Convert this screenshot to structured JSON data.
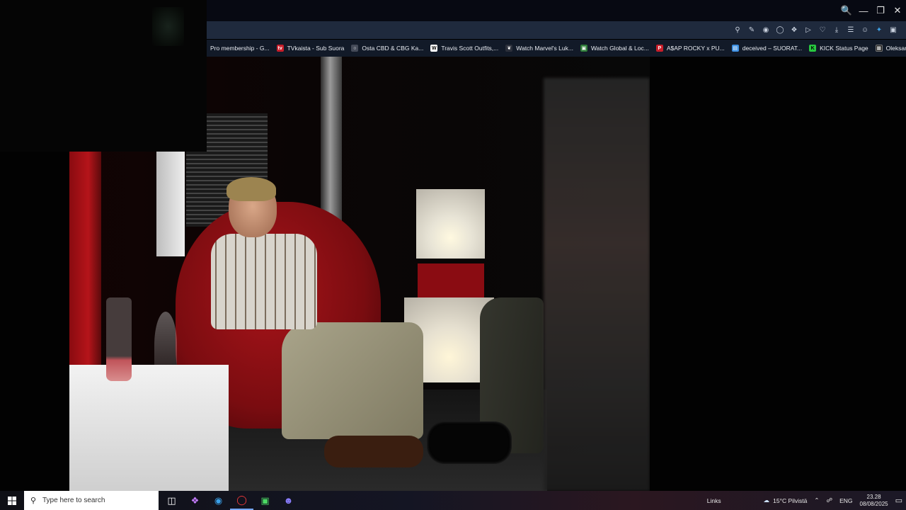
{
  "window": {
    "minimize": "—",
    "restore": "❐",
    "close": "✕"
  },
  "bookmarks": [
    {
      "label": "Pro membership - G...",
      "fav": "",
      "color": "#2d3345"
    },
    {
      "label": "TVkaista - Sub Suora",
      "fav": "tv",
      "color": "#c81e2a"
    },
    {
      "label": "Osta CBD & CBG Ka...",
      "fav": "○",
      "color": "#444a58"
    },
    {
      "label": "Travis Scott Outfits,...",
      "fav": "W",
      "color": "#ffffff"
    },
    {
      "label": "Watch Marvel's Luk...",
      "fav": "❦",
      "color": "#2b2f3a"
    },
    {
      "label": "Watch Global & Loc...",
      "fav": "▣",
      "color": "#2f7d3a"
    },
    {
      "label": "A$AP ROCKY x PU...",
      "fav": "P",
      "color": "#c81e2a"
    },
    {
      "label": "deceived – SUORAT...",
      "fav": "▤",
      "color": "#3c8ee0"
    },
    {
      "label": "KICK Status Page",
      "fav": "K",
      "color": "#28c840"
    },
    {
      "label": "Oleksandr Usyk vs D...",
      "fav": "▦",
      "color": "#1d1d1d"
    }
  ],
  "taskbar": {
    "search_placeholder": "Type here to search",
    "links": "Links",
    "weather": "15°C Pilvistä",
    "lang": "ENG",
    "time": "23.28",
    "date": "08/08/2025"
  }
}
